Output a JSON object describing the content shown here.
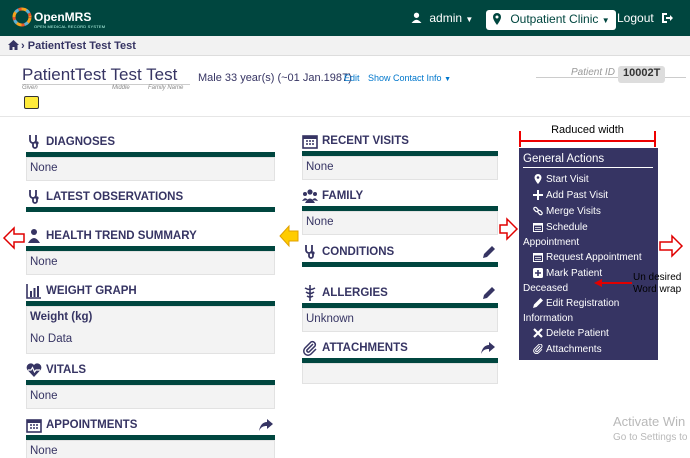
{
  "topbar": {
    "brand": "OpenMRS",
    "brand_sub": "OPEN MEDICAL RECORD SYSTEM",
    "user": "admin",
    "location": "Outpatient Clinic",
    "logout": "Logout",
    "color": "#00463f"
  },
  "breadcrumb": {
    "text": "PatientTest Test Test"
  },
  "patient": {
    "name": "PatientTest Test Test",
    "given_label": "Given",
    "middle_label": "Middle",
    "family_label": "Family Name",
    "info": "Male  33 year(s) (~01 Jan.1987)",
    "edit": "Edit",
    "show_contact": "Show Contact Info",
    "id_label": "Patient ID",
    "id_value": "10002T"
  },
  "widgets": {
    "diagnoses": {
      "title": "DIAGNOSES",
      "body": "None"
    },
    "latest_obs": {
      "title": "LATEST OBSERVATIONS"
    },
    "health_trend": {
      "title": "HEALTH TREND SUMMARY",
      "body": "None"
    },
    "weight_graph": {
      "title": "WEIGHT GRAPH",
      "body_title": "Weight (kg)",
      "body": "No Data"
    },
    "vitals": {
      "title": "VITALS",
      "body": "None"
    },
    "appointments": {
      "title": "APPOINTMENTS",
      "body": "None"
    },
    "recent_visits": {
      "title": "RECENT VISITS",
      "body": "None"
    },
    "family": {
      "title": "FAMILY",
      "body": "None"
    },
    "conditions": {
      "title": "CONDITIONS"
    },
    "allergies": {
      "title": "ALLERGIES",
      "body": "Unknown"
    },
    "attachments": {
      "title": "ATTACHMENTS"
    }
  },
  "general_actions": {
    "title": "General Actions",
    "items": [
      "Start Visit",
      "Add Past Visit",
      "Merge Visits",
      "Schedule",
      "Appointment",
      "Request Appointment",
      "Mark Patient",
      "Deceased",
      "Edit Registration",
      "Information",
      "Delete Patient",
      "Attachments"
    ],
    "color": "#363463"
  },
  "annotations": {
    "reduced_width": "Raduced width",
    "undesired_line1": "Un desired",
    "undesired_line2": "Word wrap",
    "arrow_color": "#e00000",
    "yellow_arrow_color": "#ffcc00"
  },
  "watermark": {
    "line1": "Activate Win",
    "line2": "Go to Settings to"
  }
}
